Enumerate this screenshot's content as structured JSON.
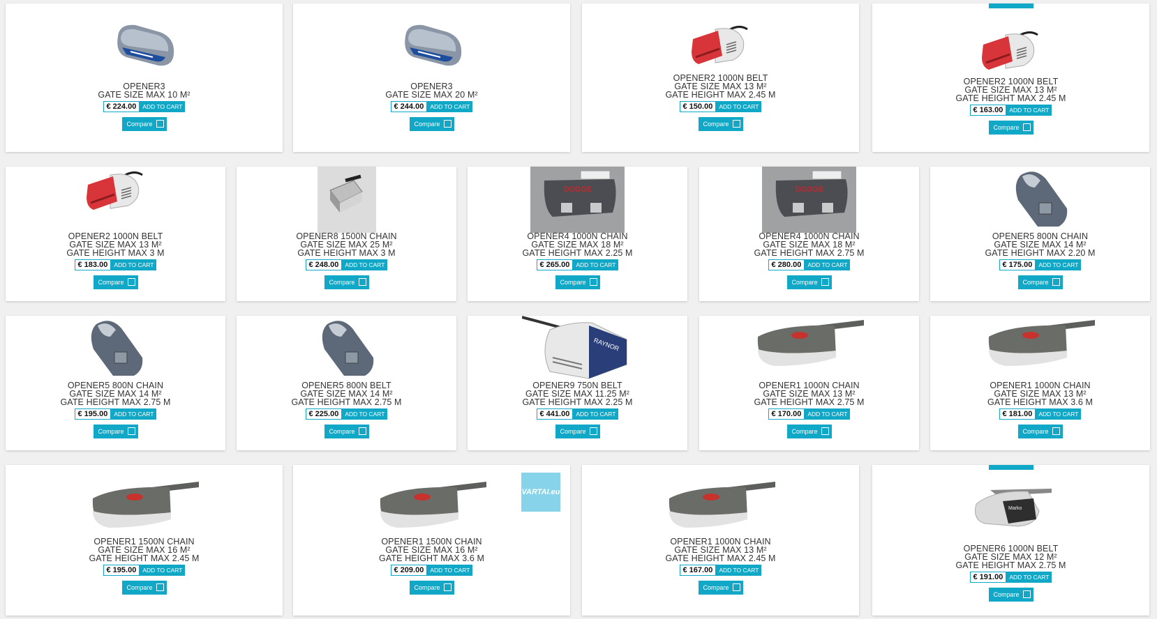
{
  "compare_label": "Compare",
  "cart_label": "ADD TO CART",
  "badge_text": "VARTAI.eu",
  "accent_color": "#11a7c7",
  "rows": [
    {
      "products": [
        {
          "lines": [
            "OPENER3",
            "GATE SIZE MAX 10 M²"
          ],
          "price": "€ 224.00",
          "image": "opener3-icon"
        },
        {
          "lines": [
            "OPENER3",
            "GATE SIZE MAX 20 M²"
          ],
          "price": "€ 244.00",
          "image": "opener3-icon"
        },
        {
          "lines": [
            "OPENER2 1000N BELT",
            "GATE SIZE MAX 13 M²",
            "GATE HEIGHT MAX 2.45 M"
          ],
          "price": "€ 150.00",
          "image": "opener2-icon"
        },
        {
          "lines": [
            "OPENER2 1000N BELT",
            "GATE SIZE MAX 13 M²",
            "GATE HEIGHT MAX 2.45 M"
          ],
          "price": "€ 163.00",
          "image": "opener2-icon"
        }
      ]
    },
    {
      "products": [
        {
          "lines": [
            "OPENER2 1000N BELT",
            "GATE SIZE MAX 13 M²",
            "GATE HEIGHT MAX 3 M"
          ],
          "price": "€ 183.00",
          "image": "opener2-icon"
        },
        {
          "lines": [
            "OPENER8 1500N CHAIN",
            "GATE SIZE MAX 25 M²",
            "GATE HEIGHT MAX 3 M"
          ],
          "price": "€ 248.00",
          "image": "opener8-icon"
        },
        {
          "lines": [
            "OPENER4 1000N CHAIN",
            "GATE SIZE MAX 18 M²",
            "GATE HEIGHT MAX 2.25 M"
          ],
          "price": "€ 265.00",
          "image": "opener4-photo"
        },
        {
          "lines": [
            "OPENER4 1000N CHAIN",
            "GATE SIZE MAX 18 M²",
            "GATE HEIGHT MAX 2.75 M"
          ],
          "price": "€ 280.00",
          "image": "opener4-photo"
        },
        {
          "lines": [
            "OPENER5 800N CHAIN",
            "GATE SIZE MAX 14 M²",
            "GATE HEIGHT MAX 2.20 M"
          ],
          "price": "€ 175.00",
          "image": "opener5-icon"
        }
      ]
    },
    {
      "products": [
        {
          "lines": [
            "OPENER5 800N CHAIN",
            "GATE SIZE MAX 14 M²",
            "GATE HEIGHT MAX 2.75 M"
          ],
          "price": "€ 195.00",
          "image": "opener5-icon"
        },
        {
          "lines": [
            "OPENER5 800N BELT",
            "GATE SIZE MAX 14 M²",
            "GATE HEIGHT MAX 2.75 M"
          ],
          "price": "€ 225.00",
          "image": "opener5-icon"
        },
        {
          "lines": [
            "OPENER9 750N BELT",
            "GATE SIZE MAX 11.25 M²",
            "GATE HEIGHT MAX 2.25 M"
          ],
          "price": "€ 441.00",
          "image": "opener9-icon"
        },
        {
          "lines": [
            "OPENER1 1000N CHAIN",
            "GATE SIZE MAX 13 M²",
            "GATE HEIGHT MAX 2.75 M"
          ],
          "price": "€ 170.00",
          "image": "opener1-icon"
        },
        {
          "lines": [
            "OPENER1 1000N CHAIN",
            "GATE SIZE MAX 13 M²",
            "GATE HEIGHT MAX 3.6 M"
          ],
          "price": "€ 181.00",
          "image": "opener1-icon"
        }
      ]
    },
    {
      "products": [
        {
          "lines": [
            "OPENER1 1500N CHAIN",
            "GATE SIZE MAX 16 M²",
            "GATE HEIGHT MAX 2.45 M"
          ],
          "price": "€ 195.00",
          "image": "opener1-icon"
        },
        {
          "lines": [
            "OPENER1 1500N CHAIN",
            "GATE SIZE MAX 16 M²",
            "GATE HEIGHT MAX 3.6 M"
          ],
          "price": "€ 209.00",
          "image": "opener1-icon"
        },
        {
          "lines": [
            "OPENER1 1000N CHAIN",
            "GATE SIZE MAX 13 M²",
            "GATE HEIGHT MAX 2.45 M"
          ],
          "price": "€ 167.00",
          "image": "opener1-icon"
        },
        {
          "lines": [
            "OPENER6 1000N BELT",
            "GATE SIZE MAX 12 M²",
            "GATE HEIGHT MAX 2.75 M"
          ],
          "price": "€ 191.00",
          "image": "opener6-icon"
        }
      ]
    }
  ]
}
